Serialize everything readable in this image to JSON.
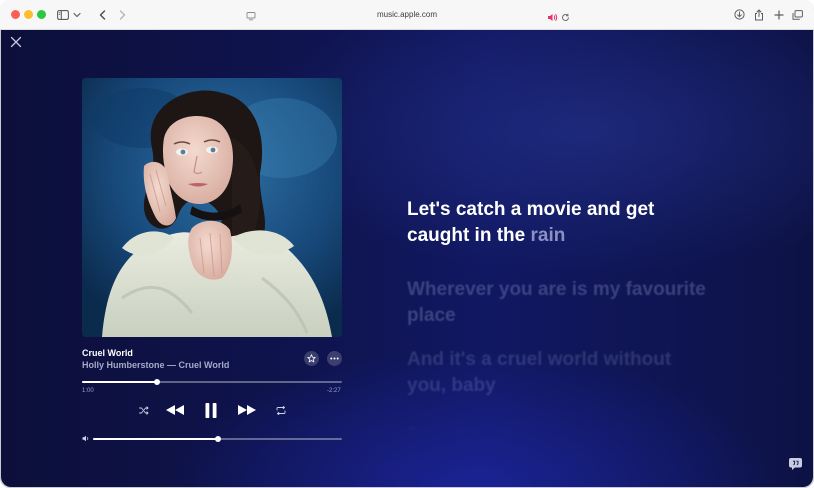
{
  "browser": {
    "url": "music.apple.com",
    "icons": [
      "sidebar-icon",
      "chevron-down-icon",
      "back-icon",
      "forward-icon",
      "site-settings-icon",
      "speaker-icon",
      "reload-icon",
      "download-icon",
      "share-icon",
      "new-tab-icon",
      "tab-overview-icon"
    ]
  },
  "player": {
    "song_title": "Cruel World",
    "song_subtitle": "Holly Humberstone — Cruel World",
    "elapsed": "1:00",
    "remaining": "-2:27",
    "progress_fraction": 0.29,
    "volume_fraction": 0.5,
    "is_playing": true,
    "controls": [
      "shuffle-icon",
      "previous-icon",
      "pause-icon",
      "next-icon",
      "repeat-icon"
    ],
    "accent_color": "#ffffff"
  },
  "lyrics": {
    "current_sung": "Let's catch a movie and get caught in the",
    "current_upcoming": "rain",
    "next_1": "Wherever you are is my favourite place",
    "next_2": "And it's a cruel world without you, baby",
    "next_3": "..."
  },
  "colors": {
    "background": "#0f1450",
    "traffic_red": "#fe5f57",
    "traffic_yellow": "#febc2e",
    "traffic_green": "#28c840",
    "speaker_active": "#e8326b"
  }
}
